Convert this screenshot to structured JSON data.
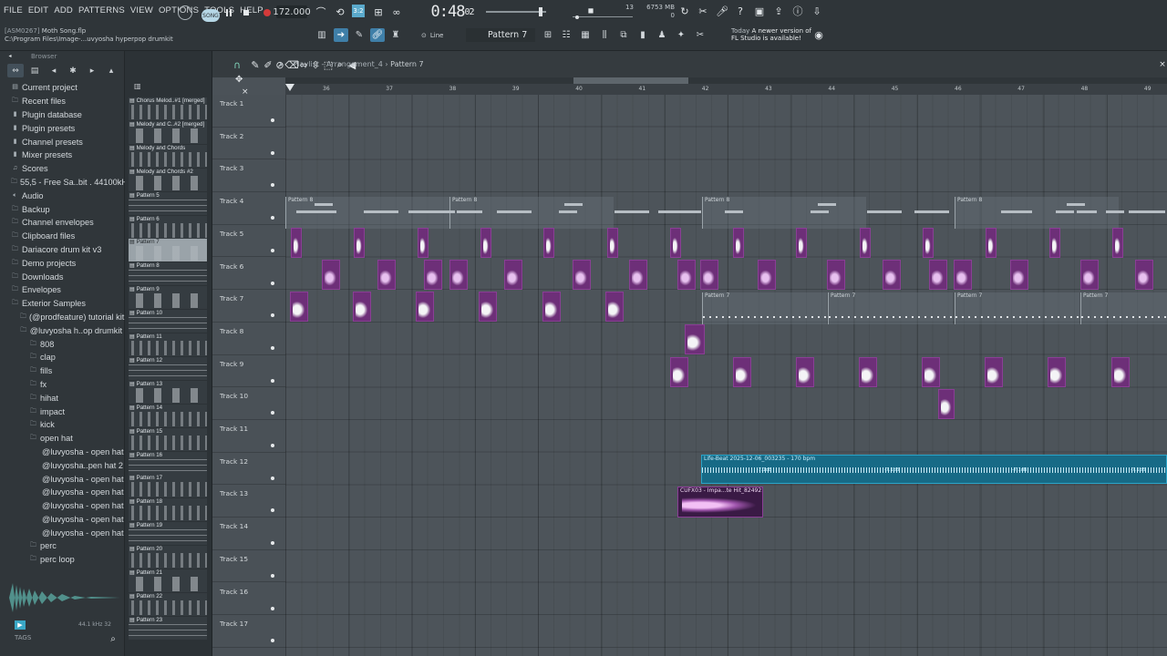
{
  "menu": [
    "FILE",
    "EDIT",
    "ADD",
    "PATTERNS",
    "VIEW",
    "OPTIONS",
    "TOOLS",
    "HELP"
  ],
  "file_info": {
    "code": "[ASM0267]",
    "name": "Moth Song.flp",
    "path": "C:\\Program Files\\Image-...uvyosha hyperpop drumkit"
  },
  "transport": {
    "mode": "SONG",
    "tempo": "172.000",
    "time": "0:48",
    "time_frac": "02"
  },
  "monitor": {
    "cpu": "13",
    "mem": "6753 MB",
    "mem2": "0"
  },
  "news": {
    "line1": "Today",
    "line1b": "A newer version of",
    "line2": "FL Studio is available!"
  },
  "toolbar": {
    "snap": "Line",
    "pattern": "Pattern 7"
  },
  "browser": {
    "title": "Browser",
    "items": [
      {
        "label": "Current project",
        "icon": "file",
        "sel": true
      },
      {
        "label": "Recent files",
        "icon": "folder"
      },
      {
        "label": "Plugin database",
        "icon": "plug"
      },
      {
        "label": "Plugin presets",
        "icon": "plug"
      },
      {
        "label": "Channel presets",
        "icon": "plug"
      },
      {
        "label": "Mixer presets",
        "icon": "plug"
      },
      {
        "label": "Scores",
        "icon": "note"
      },
      {
        "label": "55,5 - Free Sa..bit . 44100kHz]",
        "icon": "folder"
      },
      {
        "label": "Audio",
        "icon": "speaker"
      },
      {
        "label": "Backup",
        "icon": "folder"
      },
      {
        "label": "Channel envelopes",
        "icon": "folder"
      },
      {
        "label": "Clipboard files",
        "icon": "folder"
      },
      {
        "label": "Dariacore drum kit v3",
        "icon": "folder"
      },
      {
        "label": "Demo projects",
        "icon": "folder"
      },
      {
        "label": "Downloads",
        "icon": "folder"
      },
      {
        "label": "Envelopes",
        "icon": "folder"
      },
      {
        "label": "Exterior Samples",
        "icon": "folder",
        "sel": true
      },
      {
        "label": "(@prodfeature) tutorial kit",
        "icon": "folder",
        "indent": 1
      },
      {
        "label": "@luvyosha h..op drumkit",
        "icon": "folder",
        "indent": 1,
        "sel": true
      },
      {
        "label": "808",
        "icon": "folder",
        "indent": 2
      },
      {
        "label": "clap",
        "icon": "folder",
        "indent": 2
      },
      {
        "label": "fills",
        "icon": "folder",
        "indent": 2
      },
      {
        "label": "fx",
        "icon": "folder",
        "indent": 2
      },
      {
        "label": "hihat",
        "icon": "folder",
        "indent": 2
      },
      {
        "label": "impact",
        "icon": "folder",
        "indent": 2
      },
      {
        "label": "kick",
        "icon": "folder",
        "indent": 2
      },
      {
        "label": "open hat",
        "icon": "folder",
        "indent": 2
      },
      {
        "label": "@luvyosha - open hat 1",
        "icon": "wav",
        "indent": 3,
        "sel": true
      },
      {
        "label": "@luvyosha..pen hat 2",
        "icon": "wav",
        "indent": 3
      },
      {
        "label": "@luvyosha - open hat 3",
        "icon": "wav",
        "indent": 3
      },
      {
        "label": "@luvyosha - open hat 4",
        "icon": "wav",
        "indent": 3
      },
      {
        "label": "@luvyosha - open hat 5",
        "icon": "wav",
        "indent": 3
      },
      {
        "label": "@luvyosha - open hat 6",
        "icon": "wav",
        "indent": 3
      },
      {
        "label": "@luvyosha - open hat 7",
        "icon": "wav",
        "indent": 3
      },
      {
        "label": "perc",
        "icon": "folder",
        "indent": 2
      },
      {
        "label": "perc loop",
        "icon": "folder",
        "indent": 2
      }
    ],
    "sample_info": "44.1 kHz 32",
    "tags": "TAGS"
  },
  "patterns": [
    "Chorus Melod..#1 [merged]",
    "Melody and C..#2 [merged]",
    "Melody and Chords",
    "Melody and Chords #2",
    "Pattern 5",
    "Pattern 6",
    "Pattern 7",
    "Pattern 8",
    "Pattern 9",
    "Pattern 10",
    "Pattern 11",
    "Pattern 12",
    "Pattern 13",
    "Pattern 14",
    "Pattern 15",
    "Pattern 16",
    "Pattern 17",
    "Pattern 18",
    "Pattern 19",
    "Pattern 20",
    "Pattern 21",
    "Pattern 22",
    "Pattern 23"
  ],
  "playlist": {
    "title": "Playlist - Arrangement_4",
    "pattern": "Pattern 7",
    "bars": [
      "36",
      "37",
      "38",
      "39",
      "40",
      "41",
      "42",
      "43",
      "44",
      "45",
      "46",
      "47",
      "48",
      "49"
    ],
    "tracks": [
      "Track 1",
      "Track 2",
      "Track 3",
      "Track 4",
      "Track 5",
      "Track 6",
      "Track 7",
      "Track 8",
      "Track 9",
      "Track 10",
      "Track 11",
      "Track 12",
      "Track 13",
      "Track 14",
      "Track 15",
      "Track 16",
      "Track 17"
    ],
    "clips": {
      "pattern8": "Pattern 8",
      "pattern7": "Pattern 7",
      "lifebeat": "Life-Beat 2025-12-06_003235 - 170 bpm",
      "lifebeat_gain": "-7.1dB",
      "impact": "CUFX03 - Impa...te Hit_824921"
    }
  }
}
